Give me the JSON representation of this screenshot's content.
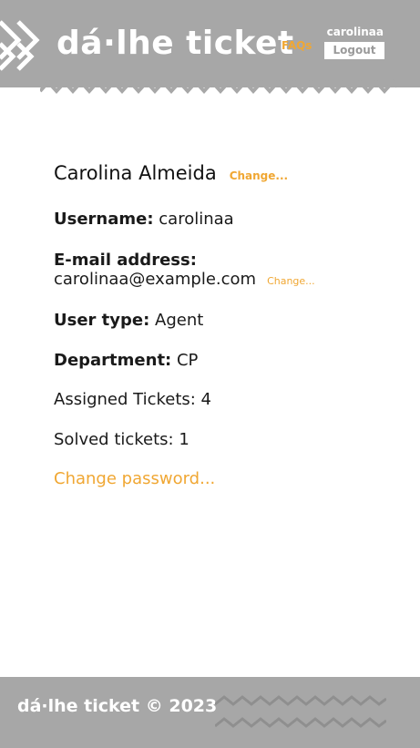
{
  "header": {
    "site_title": "dá·lhe ticket",
    "faqs_label": "FAQs",
    "username": "carolinaa",
    "logout_label": "Logout",
    "bg_color": "#a7a7a7",
    "accent_color": "#f0a733"
  },
  "profile": {
    "name": "Carolina Almeida",
    "change_name_label": "Change...",
    "username_label": "Username:",
    "username_value": "carolinaa",
    "email_label": "E-mail address:",
    "email_value": "carolinaa@example.com",
    "change_email_label": "Change...",
    "user_type_label": "User type:",
    "user_type_value": "Agent",
    "department_label": "Department:",
    "department_value": "CP",
    "assigned_tickets": "Assigned Tickets: 4",
    "solved_tickets": "Solved tickets: 1",
    "change_password_label": "Change password..."
  },
  "footer": {
    "text": "dá·lhe ticket © 2023"
  }
}
